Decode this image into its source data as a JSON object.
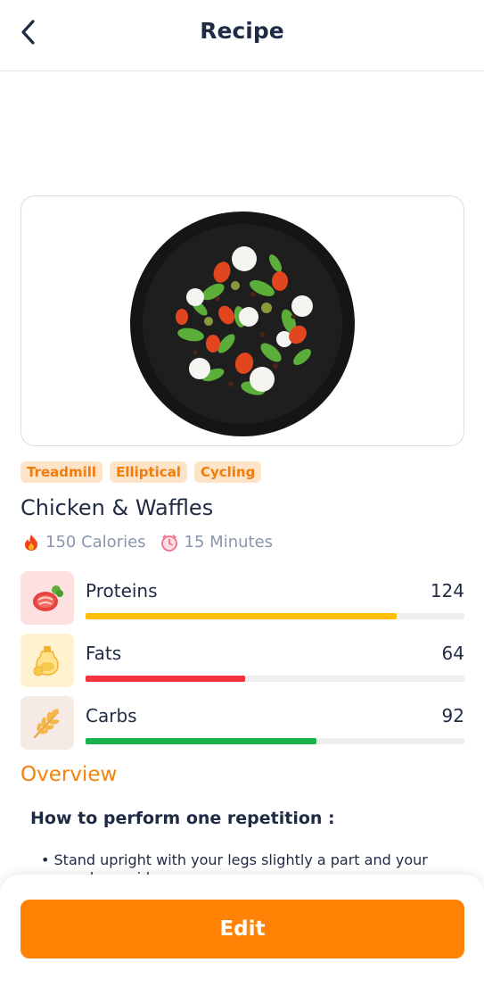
{
  "header": {
    "title": "Recipe",
    "back_icon": "chevron-left-icon"
  },
  "dish_image": {
    "description_icon": "salad-plate-icon"
  },
  "tags": [
    "Treadmill",
    "Elliptical",
    "Cycling"
  ],
  "recipe": {
    "title": "Chicken & Waffles",
    "calories": "150 Calories",
    "minutes": "15 Minutes"
  },
  "nutrients": [
    {
      "name": "Proteins",
      "value": "124",
      "progress_percent": 82,
      "color": "#ffbf00",
      "icon": "meat-icon",
      "icon_bg": "#fde1e1"
    },
    {
      "name": "Fats",
      "value": "64",
      "progress_percent": 42,
      "color": "#f5333f",
      "icon": "oil-bottle-icon",
      "icon_bg": "#fff3cf"
    },
    {
      "name": "Carbs",
      "value": "92",
      "progress_percent": 61,
      "color": "#19b24b",
      "icon": "wheat-icon",
      "icon_bg": "#f6ebe4"
    }
  ],
  "overview": {
    "label": "Overview",
    "heading": "How to perform one repetition :",
    "bullet": "• Stand upright with your legs slightly a part and your arms above sides"
  },
  "actions": {
    "edit_label": "Edit"
  },
  "colors": {
    "accent": "#ff8205",
    "text": "#1f2a44",
    "muted": "#8a96ad"
  }
}
